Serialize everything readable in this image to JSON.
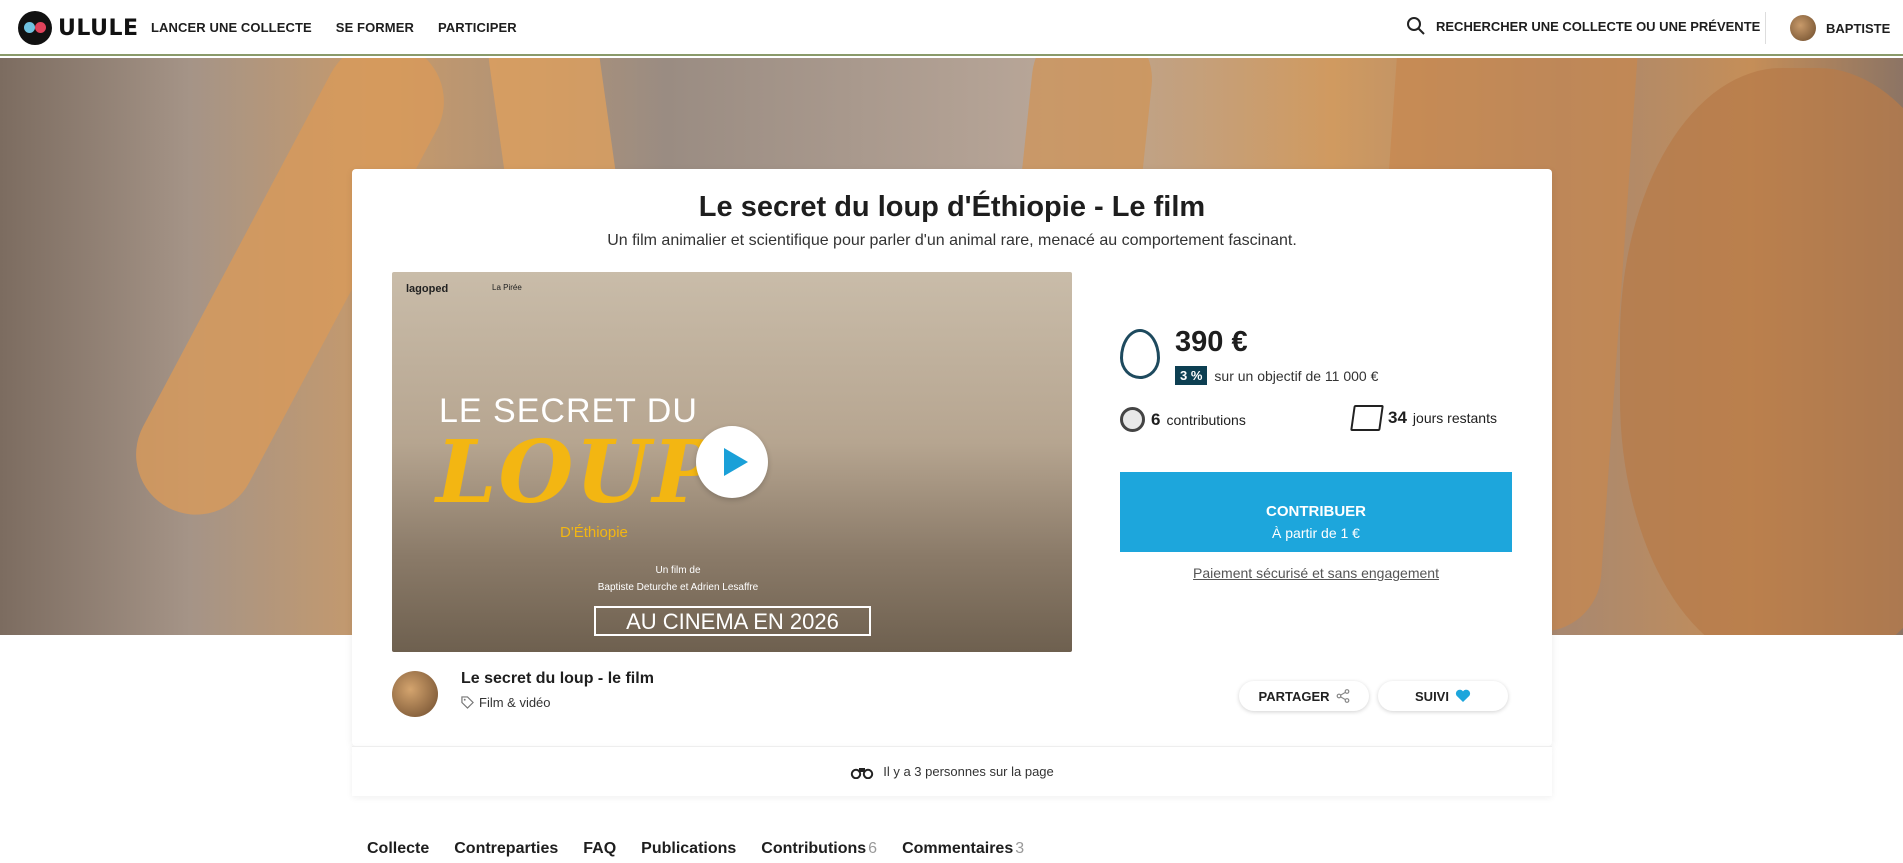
{
  "header": {
    "logo_text": "ULULE",
    "nav": [
      "LANCER UNE COLLECTE",
      "SE FORMER",
      "PARTICIPER"
    ],
    "search_label": "RECHERCHER UNE COLLECTE OU UNE PRÉVENTE",
    "user_name": "BAPTISTE"
  },
  "project": {
    "title": "Le secret du loup d'Éthiopie - Le film",
    "subtitle": "Un film animalier et scientifique pour parler d'un animal rare, menacé au comportement fascinant."
  },
  "video": {
    "logos": [
      "lagoped",
      "La Pirée"
    ],
    "line1": "LE SECRET DU",
    "line2": "LOUP",
    "line3": "D'Éthiopie",
    "credits_1": "Un film de",
    "credits_2": "Baptiste Deturche et Adrien Lesaffre",
    "release": "AU CINEMA EN 2026"
  },
  "stats": {
    "amount": "390 €",
    "percent": "3 %",
    "goal": "sur un objectif de 11 000 €",
    "contributions_count": "6",
    "contributions_label": "contributions",
    "days_count": "34",
    "days_label": "jours restants",
    "cta_label": "CONTRIBUER",
    "cta_sub": "À partir de 1 €",
    "secure_text": "Paiement sécurisé et sans engagement"
  },
  "creator": {
    "name": "Le secret du loup - le film",
    "category": "Film & vidéo",
    "share_label": "PARTAGER",
    "follow_label": "SUIVI"
  },
  "presence": "Il y a 3 personnes sur la page",
  "tabs": [
    {
      "label": "Collecte",
      "count": ""
    },
    {
      "label": "Contreparties",
      "count": ""
    },
    {
      "label": "FAQ",
      "count": ""
    },
    {
      "label": "Publications",
      "count": ""
    },
    {
      "label": "Contributions",
      "count": "6"
    },
    {
      "label": "Commentaires",
      "count": "3"
    }
  ],
  "colors": {
    "accent": "#1da6dc",
    "badge": "#0d3f52",
    "loup_yellow": "#f3b612"
  }
}
